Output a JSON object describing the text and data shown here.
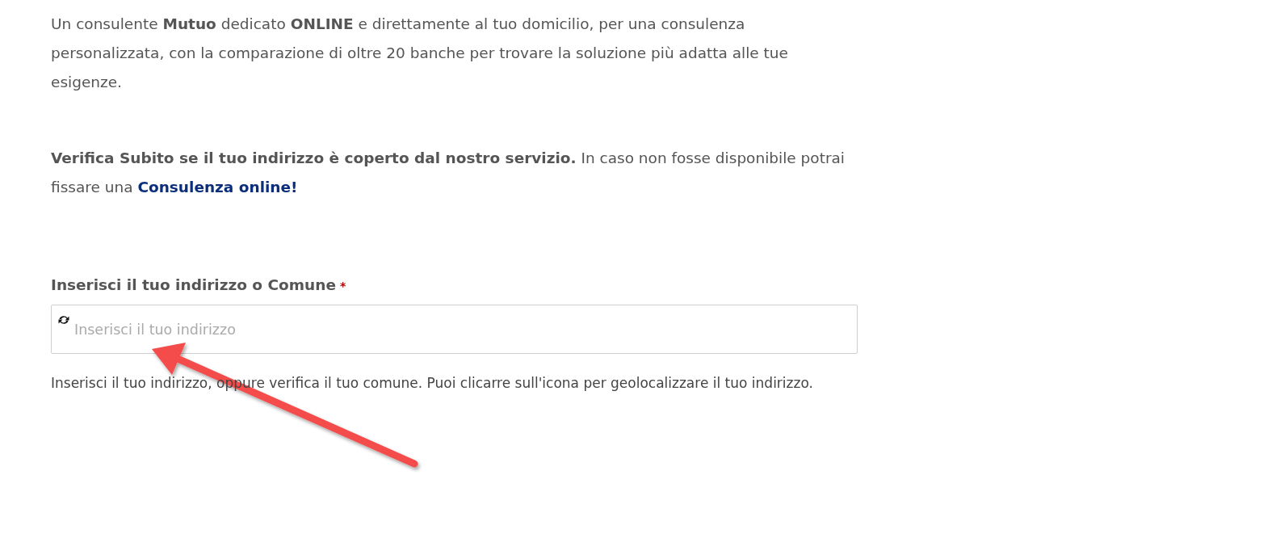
{
  "intro": "Un consulente **Mutuo** dedicato **ONLINE** e direttamente al tuo domicilio, per una consulenza personalizzata, con la comparazione di oltre 20 banche per trovare la soluzione più adatta alle tue esigenze.",
  "verify": {
    "text": "**Verifica Subito se il tuo indirizzo è coperto dal nostro servizio.** In caso non fosse disponibile potrai fissare una ",
    "link": "Consulenza online!"
  },
  "address_field": {
    "label": "Inserisci il tuo indirizzo o Comune",
    "required_mark": "*",
    "placeholder": "Inserisci il tuo indirizzo",
    "help": "Inserisci il tuo indirizzo, oppure verifica il tuo comune. Puoi clicarre sull'icona per geolocalizzare il tuo indirizzo."
  },
  "annotation": {
    "kind": "arrow"
  }
}
